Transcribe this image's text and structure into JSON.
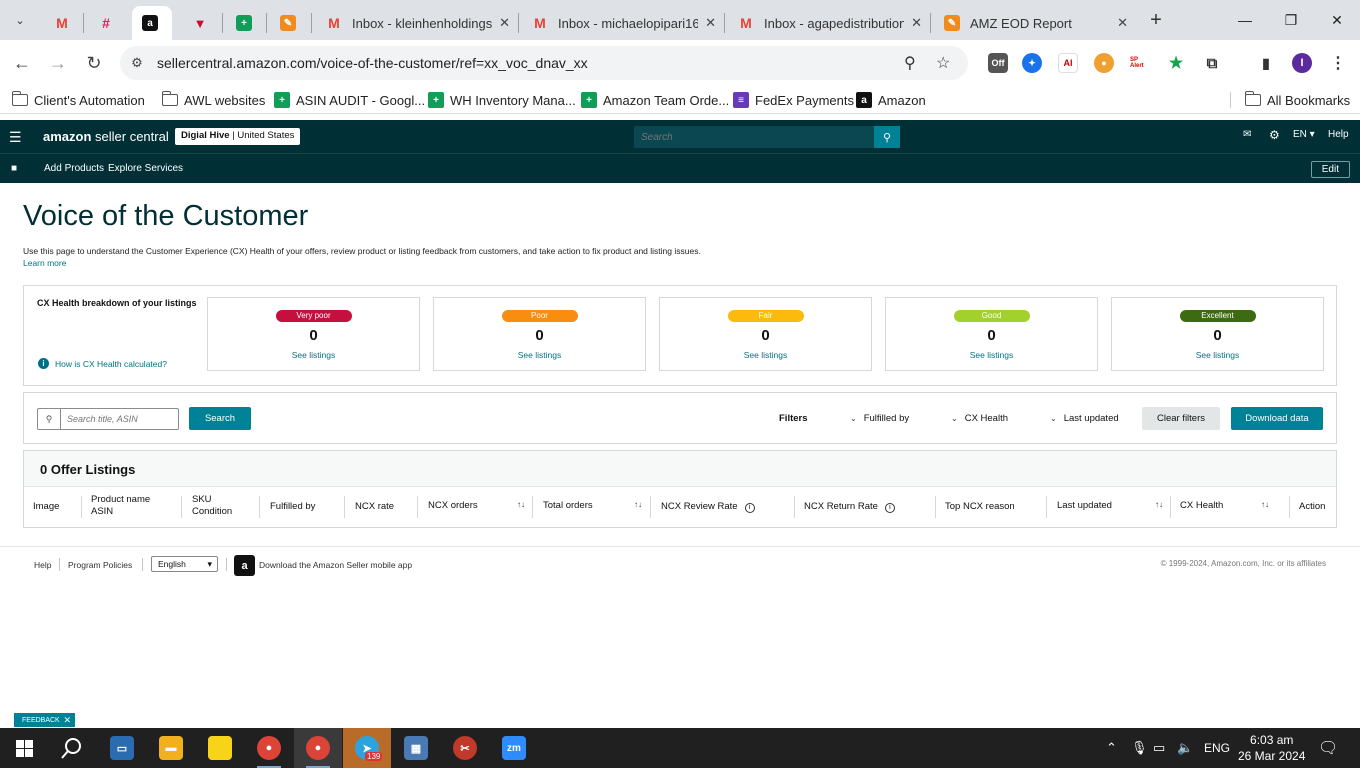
{
  "browser": {
    "tabs": [
      {
        "title": "",
        "icon": "gmail-icon",
        "color": "#ea4335"
      },
      {
        "title": "",
        "icon": "slack-icon",
        "color": "#e01e5a"
      },
      {
        "title": "",
        "icon": "amazon-icon",
        "color": "#111111"
      },
      {
        "title": "",
        "icon": "app-icon",
        "color": "#c8102e"
      },
      {
        "title": "",
        "icon": "sheets-icon",
        "color": "#0f9d58"
      },
      {
        "title": "",
        "icon": "pencil-icon",
        "color": "#f28b1d"
      },
      {
        "title": "Inbox - kleinhenholdingsll",
        "icon": "gmail-icon",
        "color": "#ea4335"
      },
      {
        "title": "Inbox - michaelopipari16",
        "icon": "gmail-icon",
        "color": "#ea4335"
      },
      {
        "title": "Inbox - agapedistribution",
        "icon": "gmail-icon",
        "color": "#ea4335"
      },
      {
        "title": "AMZ EOD Report",
        "icon": "pencil-icon",
        "color": "#f28b1d"
      }
    ],
    "url": "sellercentral.amazon.com/voice-of-the-customer/ref=xx_voc_dnav_xx",
    "bookmarks": [
      {
        "label": "Client's Automation",
        "type": "folder"
      },
      {
        "label": "AWL websites",
        "type": "folder"
      },
      {
        "label": "ASIN AUDIT - Googl...",
        "type": "sheets"
      },
      {
        "label": "WH Inventory Mana...",
        "type": "sheets"
      },
      {
        "label": "Amazon Team Orde...",
        "type": "sheets"
      },
      {
        "label": "FedEx Payments",
        "type": "forms"
      },
      {
        "label": "Amazon",
        "type": "amazon"
      }
    ],
    "all_bookmarks": "All Bookmarks",
    "extensions": {
      "off_badge": "Off",
      "sp_alert": "SP Alert"
    },
    "profile_initial": "I"
  },
  "sc": {
    "logo_bold": "amazon",
    "logo_rest": " seller central",
    "account_name": "Digial Hive",
    "account_region": "United States",
    "search_placeholder": "Search",
    "lang": "EN",
    "help": "Help",
    "nav_links": [
      "Add Products",
      "Explore Services"
    ],
    "edit": "Edit"
  },
  "page": {
    "title": "Voice of the Customer",
    "description": "Use this page to understand the Customer Experience (CX) Health of your offers, review product or listing feedback from customers, and take action to fix product and listing issues.",
    "learn_more": "Learn more",
    "cx_heading": "CX Health breakdown of your listings",
    "cx_how": "How is CX Health calculated?",
    "cx_cards": [
      {
        "label": "Very poor",
        "count": "0",
        "link": "See listings",
        "color": "#c40f3f"
      },
      {
        "label": "Poor",
        "count": "0",
        "link": "See listings",
        "color": "#f88d10"
      },
      {
        "label": "Fair",
        "count": "0",
        "link": "See listings",
        "color": "#fcbb0c"
      },
      {
        "label": "Good",
        "count": "0",
        "link": "See listings",
        "color": "#a2d12d"
      },
      {
        "label": "Excellent",
        "count": "0",
        "link": "See listings",
        "color": "#3c6b12"
      }
    ],
    "search_placeholder": "Search title, ASIN",
    "search_btn": "Search",
    "filters_label": "Filters",
    "filters": [
      "Fulfilled by",
      "CX Health",
      "Last updated"
    ],
    "clear_filters": "Clear filters",
    "download": "Download data",
    "listings_title": "0 Offer Listings",
    "columns": {
      "image": "Image",
      "product_name": "Product name",
      "asin": "ASIN",
      "sku": "SKU",
      "condition": "Condition",
      "fulfilled_by": "Fulfilled by",
      "ncx_rate": "NCX rate",
      "ncx_orders": "NCX orders",
      "total_orders": "Total orders",
      "ncx_review_rate": "NCX Review Rate",
      "ncx_return_rate": "NCX Return Rate",
      "top_ncx_reason": "Top NCX reason",
      "last_updated": "Last updated",
      "cx_health": "CX Health",
      "action": "Action"
    }
  },
  "footer": {
    "help": "Help",
    "program_policies": "Program Policies",
    "language": "English",
    "app_text": "Download the Amazon Seller mobile app",
    "copyright": "© 1999-2024, Amazon.com, Inc. or its affiliates"
  },
  "feedback": "FEEDBACK",
  "taskbar": {
    "telegram_badge": "139",
    "lang": "ENG",
    "time": "6:03 am",
    "date": "26 Mar 2024"
  }
}
